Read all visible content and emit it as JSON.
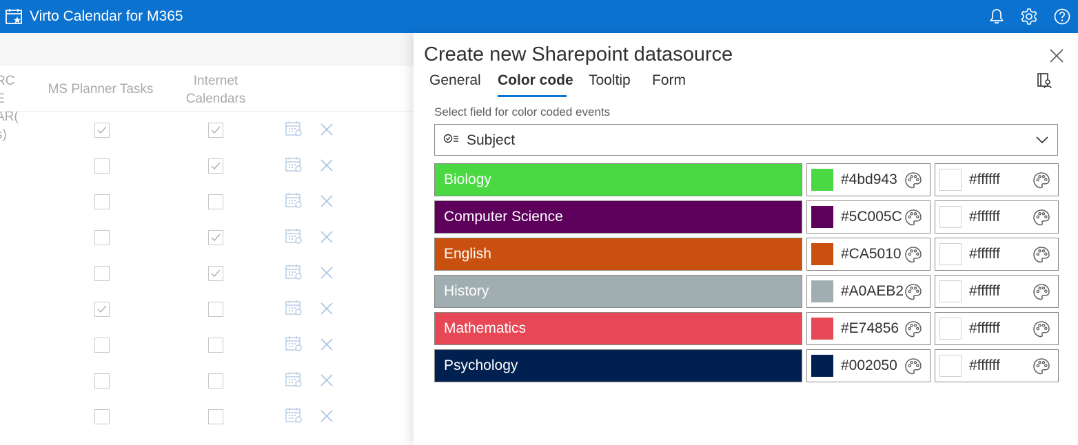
{
  "app": {
    "title": "Virto Calendar for M365",
    "icons": [
      "calendar-star-icon",
      "bell-icon",
      "gear-icon",
      "help-icon"
    ],
    "accent": "#0b72d0"
  },
  "background": {
    "headers": [
      "RCE AR(s)",
      "MS Planner Tasks",
      "Internet Calendars"
    ],
    "rows": [
      {
        "planner": true,
        "internet": true
      },
      {
        "planner": false,
        "internet": true
      },
      {
        "planner": false,
        "internet": false
      },
      {
        "planner": false,
        "internet": true
      },
      {
        "planner": false,
        "internet": true
      },
      {
        "planner": true,
        "internet": false
      },
      {
        "planner": false,
        "internet": false
      },
      {
        "planner": false,
        "internet": false
      },
      {
        "planner": false,
        "internet": false
      }
    ]
  },
  "panel": {
    "title": "Create new Sharepoint datasource",
    "tabs": [
      {
        "label": "General",
        "active": false
      },
      {
        "label": "Color code",
        "active": true
      },
      {
        "label": "Tooltip",
        "active": false
      },
      {
        "label": "Form",
        "active": false
      }
    ],
    "color_field_label": "Select field for color coded events",
    "color_field_value": "Subject",
    "color_rows": [
      {
        "name": "Biology",
        "bg": "#4bd943",
        "fg": "#ffffff"
      },
      {
        "name": "Computer Science",
        "bg": "#5C005C",
        "fg": "#ffffff"
      },
      {
        "name": "English",
        "bg": "#CA5010",
        "fg": "#ffffff"
      },
      {
        "name": "History",
        "bg": "#A0AEB2",
        "fg": "#ffffff"
      },
      {
        "name": "Mathematics",
        "bg": "#E74856",
        "fg": "#ffffff"
      },
      {
        "name": "Psychology",
        "bg": "#002050",
        "fg": "#ffffff"
      }
    ],
    "fg_hex_labels": [
      "#ffffff",
      "#ffffff",
      "#ffffff",
      "#ffffff",
      "#ffffff",
      "#ffffff"
    ]
  }
}
